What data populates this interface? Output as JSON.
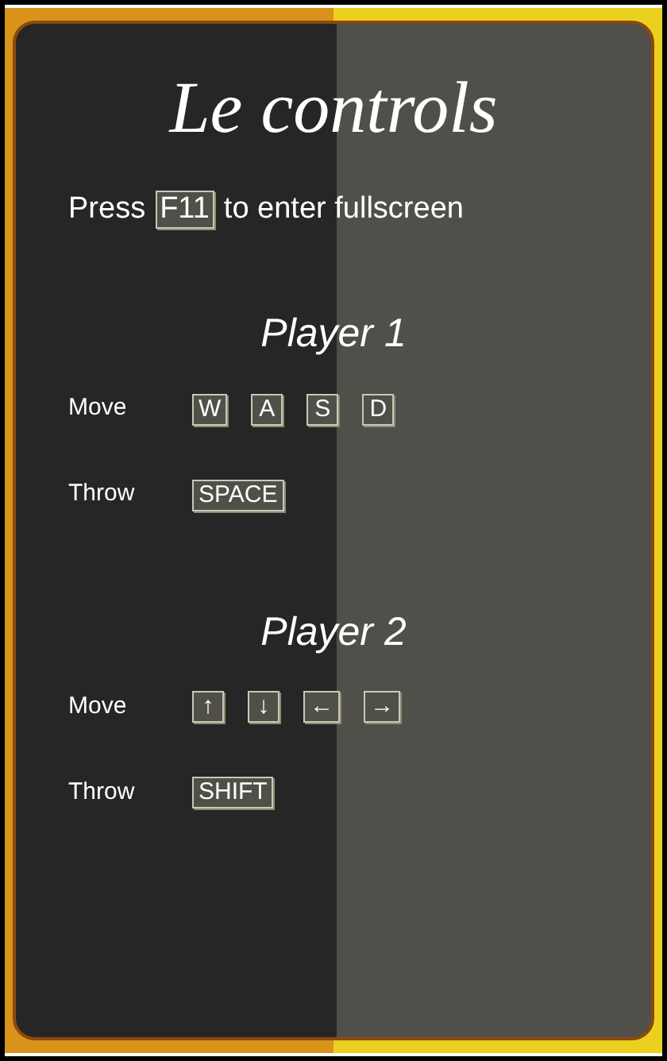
{
  "title": "Le controls",
  "fullscreen_hint": {
    "before": "Press",
    "key": "F11",
    "after": "to enter fullscreen"
  },
  "players": [
    {
      "name": "Player 1",
      "bindings": [
        {
          "action": "Move",
          "keys": [
            "W",
            "A",
            "S",
            "D"
          ]
        },
        {
          "action": "Throw",
          "keys": [
            "SPACE"
          ]
        }
      ]
    },
    {
      "name": "Player 2",
      "bindings": [
        {
          "action": "Move",
          "keys": [
            "↑",
            "↓",
            "←",
            "→"
          ]
        },
        {
          "action": "Throw",
          "keys": [
            "SHIFT"
          ]
        }
      ]
    }
  ]
}
